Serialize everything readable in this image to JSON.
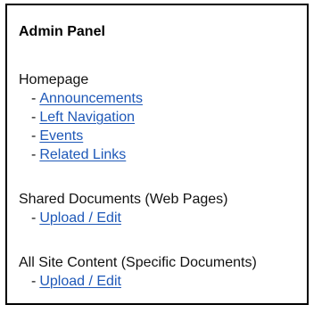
{
  "panel": {
    "title": "Admin Panel",
    "sections": [
      {
        "heading": "Homepage",
        "links": [
          {
            "dash": "-",
            "label": "Announcements"
          },
          {
            "dash": "-",
            "label": "Left Navigation"
          },
          {
            "dash": "-",
            "label": "Events"
          },
          {
            "dash": "-",
            "label": "Related Links"
          }
        ]
      },
      {
        "heading": "Shared Documents (Web Pages)",
        "links": [
          {
            "dash": "-",
            "label": "Upload / Edit"
          }
        ]
      },
      {
        "heading": "All Site Content (Specific Documents)",
        "links": [
          {
            "dash": "-",
            "label": "Upload / Edit"
          }
        ]
      }
    ]
  },
  "colors": {
    "link": "#1e58b8",
    "border": "#000000",
    "text": "#111111"
  }
}
